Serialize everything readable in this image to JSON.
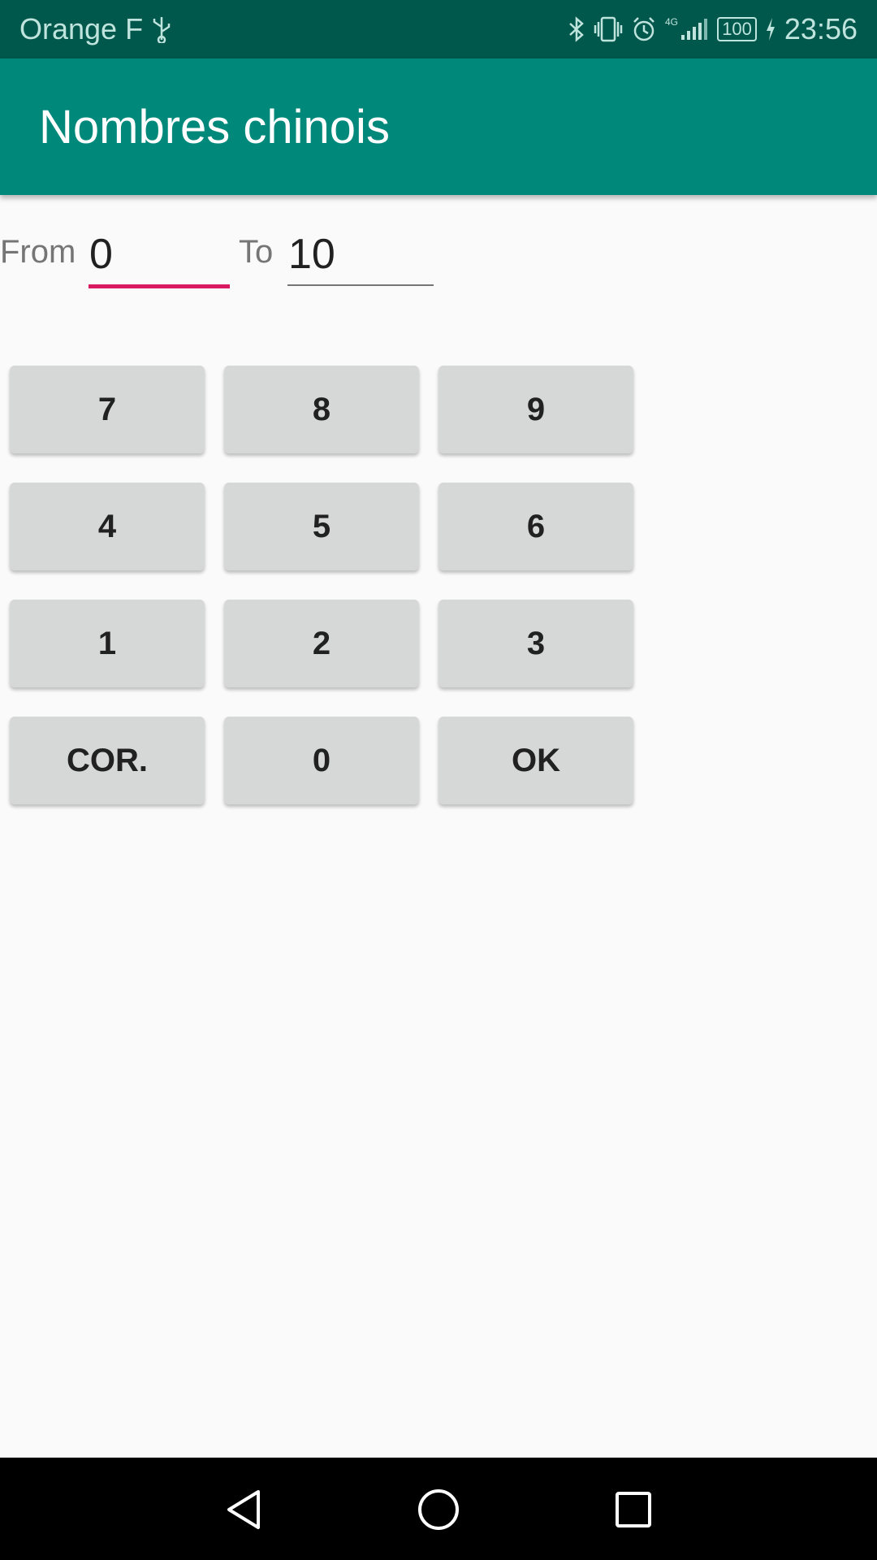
{
  "status_bar": {
    "carrier": "Orange F",
    "network": "4G",
    "battery": "100",
    "time": "23:56",
    "icons": [
      "usb-icon",
      "bluetooth-icon",
      "vibrate-icon",
      "alarm-icon",
      "signal-icon",
      "battery-icon",
      "charging-icon"
    ]
  },
  "app_bar": {
    "title": "Nombres chinois",
    "color": "#00897B"
  },
  "range": {
    "from_label": "From",
    "from_value": "0",
    "to_label": "To",
    "to_value": "10",
    "accent_color": "#D81B60"
  },
  "keypad": {
    "rows": [
      [
        "7",
        "8",
        "9"
      ],
      [
        "4",
        "5",
        "6"
      ],
      [
        "1",
        "2",
        "3"
      ],
      [
        "COR.",
        "0",
        "OK"
      ]
    ]
  },
  "nav_bar": {
    "buttons": [
      "back-icon",
      "home-icon",
      "recents-icon"
    ]
  }
}
